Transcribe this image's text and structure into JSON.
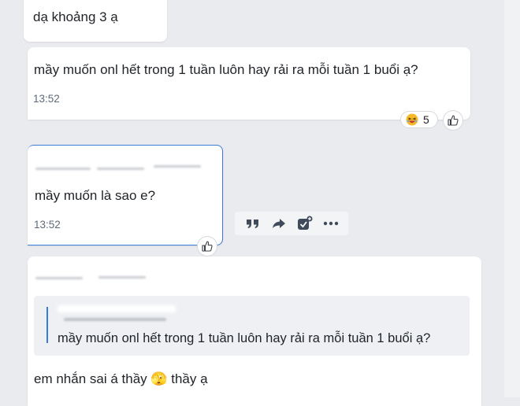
{
  "messages": [
    {
      "text": "dạ khoảng 3 ạ"
    },
    {
      "text": "mầy muốn onl hết trong 1 tuần luôn hay rải ra mỗi tuần 1 buổi ạ?",
      "time": "13:52",
      "reaction": {
        "emoji": "laughing-emoji",
        "count": "5"
      }
    },
    {
      "text": "mầy muốn là sao e?",
      "time": "13:52"
    },
    {
      "quote_text": "mầy muốn onl hết trong 1 tuần luôn hay rải ra mỗi tuần 1 buổi ạ?",
      "text": "em nhắn sai á thầy 🫣 thầy ạ"
    }
  ],
  "toolbar": {
    "icons": [
      "quote-icon",
      "forward-icon",
      "add-task-icon",
      "more-icon"
    ]
  },
  "colors": {
    "background": "#e9ebee",
    "bubble": "#ffffff",
    "selected_border": "#3b7bdc",
    "quote_bg": "#eef0f3",
    "quote_bar": "#3b7bdc"
  }
}
